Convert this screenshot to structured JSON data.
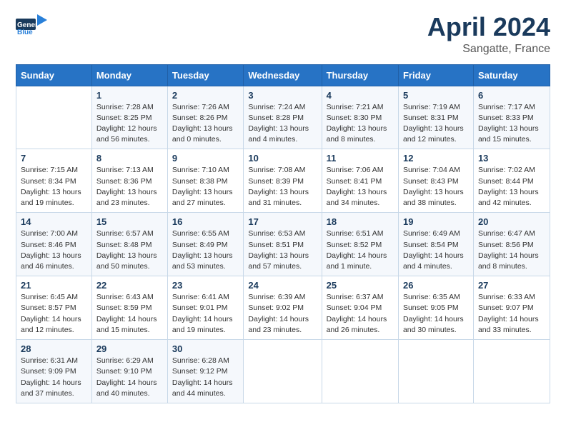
{
  "header": {
    "logo_general": "General",
    "logo_blue": "Blue",
    "title": "April 2024",
    "location": "Sangatte, France"
  },
  "columns": [
    "Sunday",
    "Monday",
    "Tuesday",
    "Wednesday",
    "Thursday",
    "Friday",
    "Saturday"
  ],
  "weeks": [
    [
      {
        "day": "",
        "info": ""
      },
      {
        "day": "1",
        "info": "Sunrise: 7:28 AM\nSunset: 8:25 PM\nDaylight: 12 hours\nand 56 minutes."
      },
      {
        "day": "2",
        "info": "Sunrise: 7:26 AM\nSunset: 8:26 PM\nDaylight: 13 hours\nand 0 minutes."
      },
      {
        "day": "3",
        "info": "Sunrise: 7:24 AM\nSunset: 8:28 PM\nDaylight: 13 hours\nand 4 minutes."
      },
      {
        "day": "4",
        "info": "Sunrise: 7:21 AM\nSunset: 8:30 PM\nDaylight: 13 hours\nand 8 minutes."
      },
      {
        "day": "5",
        "info": "Sunrise: 7:19 AM\nSunset: 8:31 PM\nDaylight: 13 hours\nand 12 minutes."
      },
      {
        "day": "6",
        "info": "Sunrise: 7:17 AM\nSunset: 8:33 PM\nDaylight: 13 hours\nand 15 minutes."
      }
    ],
    [
      {
        "day": "7",
        "info": "Sunrise: 7:15 AM\nSunset: 8:34 PM\nDaylight: 13 hours\nand 19 minutes."
      },
      {
        "day": "8",
        "info": "Sunrise: 7:13 AM\nSunset: 8:36 PM\nDaylight: 13 hours\nand 23 minutes."
      },
      {
        "day": "9",
        "info": "Sunrise: 7:10 AM\nSunset: 8:38 PM\nDaylight: 13 hours\nand 27 minutes."
      },
      {
        "day": "10",
        "info": "Sunrise: 7:08 AM\nSunset: 8:39 PM\nDaylight: 13 hours\nand 31 minutes."
      },
      {
        "day": "11",
        "info": "Sunrise: 7:06 AM\nSunset: 8:41 PM\nDaylight: 13 hours\nand 34 minutes."
      },
      {
        "day": "12",
        "info": "Sunrise: 7:04 AM\nSunset: 8:43 PM\nDaylight: 13 hours\nand 38 minutes."
      },
      {
        "day": "13",
        "info": "Sunrise: 7:02 AM\nSunset: 8:44 PM\nDaylight: 13 hours\nand 42 minutes."
      }
    ],
    [
      {
        "day": "14",
        "info": "Sunrise: 7:00 AM\nSunset: 8:46 PM\nDaylight: 13 hours\nand 46 minutes."
      },
      {
        "day": "15",
        "info": "Sunrise: 6:57 AM\nSunset: 8:48 PM\nDaylight: 13 hours\nand 50 minutes."
      },
      {
        "day": "16",
        "info": "Sunrise: 6:55 AM\nSunset: 8:49 PM\nDaylight: 13 hours\nand 53 minutes."
      },
      {
        "day": "17",
        "info": "Sunrise: 6:53 AM\nSunset: 8:51 PM\nDaylight: 13 hours\nand 57 minutes."
      },
      {
        "day": "18",
        "info": "Sunrise: 6:51 AM\nSunset: 8:52 PM\nDaylight: 14 hours\nand 1 minute."
      },
      {
        "day": "19",
        "info": "Sunrise: 6:49 AM\nSunset: 8:54 PM\nDaylight: 14 hours\nand 4 minutes."
      },
      {
        "day": "20",
        "info": "Sunrise: 6:47 AM\nSunset: 8:56 PM\nDaylight: 14 hours\nand 8 minutes."
      }
    ],
    [
      {
        "day": "21",
        "info": "Sunrise: 6:45 AM\nSunset: 8:57 PM\nDaylight: 14 hours\nand 12 minutes."
      },
      {
        "day": "22",
        "info": "Sunrise: 6:43 AM\nSunset: 8:59 PM\nDaylight: 14 hours\nand 15 minutes."
      },
      {
        "day": "23",
        "info": "Sunrise: 6:41 AM\nSunset: 9:01 PM\nDaylight: 14 hours\nand 19 minutes."
      },
      {
        "day": "24",
        "info": "Sunrise: 6:39 AM\nSunset: 9:02 PM\nDaylight: 14 hours\nand 23 minutes."
      },
      {
        "day": "25",
        "info": "Sunrise: 6:37 AM\nSunset: 9:04 PM\nDaylight: 14 hours\nand 26 minutes."
      },
      {
        "day": "26",
        "info": "Sunrise: 6:35 AM\nSunset: 9:05 PM\nDaylight: 14 hours\nand 30 minutes."
      },
      {
        "day": "27",
        "info": "Sunrise: 6:33 AM\nSunset: 9:07 PM\nDaylight: 14 hours\nand 33 minutes."
      }
    ],
    [
      {
        "day": "28",
        "info": "Sunrise: 6:31 AM\nSunset: 9:09 PM\nDaylight: 14 hours\nand 37 minutes."
      },
      {
        "day": "29",
        "info": "Sunrise: 6:29 AM\nSunset: 9:10 PM\nDaylight: 14 hours\nand 40 minutes."
      },
      {
        "day": "30",
        "info": "Sunrise: 6:28 AM\nSunset: 9:12 PM\nDaylight: 14 hours\nand 44 minutes."
      },
      {
        "day": "",
        "info": ""
      },
      {
        "day": "",
        "info": ""
      },
      {
        "day": "",
        "info": ""
      },
      {
        "day": "",
        "info": ""
      }
    ]
  ]
}
